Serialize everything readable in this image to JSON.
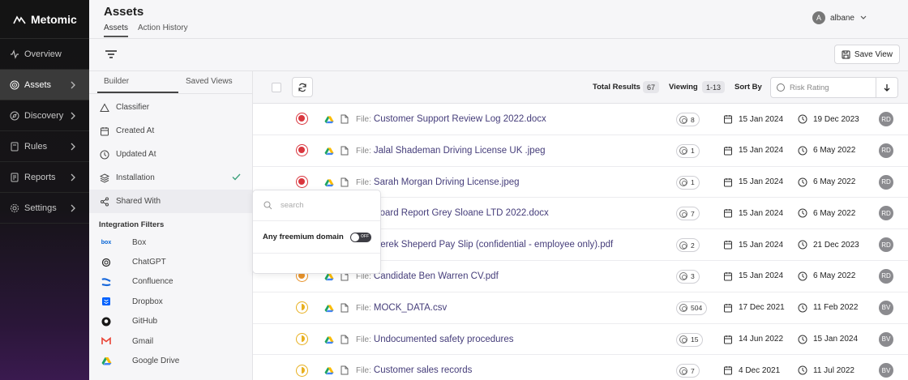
{
  "app": {
    "name": "Metomic"
  },
  "sidebar": {
    "items": [
      {
        "label": "Overview",
        "icon": "activity-icon"
      },
      {
        "label": "Assets",
        "icon": "target-icon",
        "active": true
      },
      {
        "label": "Discovery",
        "icon": "compass-icon"
      },
      {
        "label": "Rules",
        "icon": "book-icon"
      },
      {
        "label": "Reports",
        "icon": "report-icon"
      },
      {
        "label": "Settings",
        "icon": "gear-icon"
      }
    ]
  },
  "header": {
    "title": "Assets",
    "tabs": [
      {
        "label": "Assets",
        "active": true
      },
      {
        "label": "Action History"
      }
    ],
    "user": {
      "initial": "A",
      "name": "albane"
    }
  },
  "toolbar": {
    "save_label": "Save View"
  },
  "panel": {
    "tabs": [
      {
        "label": "Builder",
        "active": true
      },
      {
        "label": "Saved Views"
      }
    ],
    "filters": [
      {
        "label": "Classifier",
        "icon": "triangle-icon"
      },
      {
        "label": "Created At",
        "icon": "calendar-icon"
      },
      {
        "label": "Updated At",
        "icon": "clock-icon"
      },
      {
        "label": "Installation",
        "icon": "layers-icon",
        "checked": true
      },
      {
        "label": "Shared With",
        "icon": "share-icon",
        "selected": true
      }
    ],
    "integration_heading": "Integration Filters",
    "integrations": [
      {
        "label": "Box",
        "icon": "box-icon",
        "color": "#0061d5"
      },
      {
        "label": "ChatGPT",
        "icon": "chatgpt-icon",
        "color": "#222222"
      },
      {
        "label": "Confluence",
        "icon": "confluence-icon",
        "color": "#1868db"
      },
      {
        "label": "Dropbox",
        "icon": "dropbox-icon",
        "color": "#0061fe"
      },
      {
        "label": "GitHub",
        "icon": "github-icon",
        "color": "#181717"
      },
      {
        "label": "Gmail",
        "icon": "gmail-icon",
        "color": "#ea4335"
      },
      {
        "label": "Google Drive",
        "icon": "google-drive-icon",
        "color": "#1fa463"
      }
    ]
  },
  "table": {
    "total_label": "Total Results",
    "total_value": "67",
    "viewing_label": "Viewing",
    "viewing_value": "1-13",
    "sort_label": "Sort By",
    "sort_value": "Risk Rating",
    "file_prefix": "File:",
    "rows": [
      {
        "risk": "high",
        "name": "Customer Support Review Log 2022.docx",
        "count": "8",
        "created": "15 Jan 2024",
        "updated": "19 Dec 2023",
        "owner": "RD"
      },
      {
        "risk": "high",
        "name": "Jalal Shademan Driving License UK .jpeg",
        "count": "1",
        "created": "15 Jan 2024",
        "updated": "6 May 2022",
        "owner": "RD"
      },
      {
        "risk": "high",
        "name": "Sarah Morgan Driving License.jpeg",
        "count": "1",
        "created": "15 Jan 2024",
        "updated": "6 May 2022",
        "owner": "RD"
      },
      {
        "risk": "high",
        "name": "Board Report Grey Sloane LTD 2022.docx",
        "count": "7",
        "created": "15 Jan 2024",
        "updated": "6 May 2022",
        "owner": "RD"
      },
      {
        "risk": "high",
        "name": "Derek Sheperd Pay Slip (confidential - employee only).pdf",
        "count": "2",
        "created": "15 Jan 2024",
        "updated": "21 Dec 2023",
        "owner": "RD"
      },
      {
        "risk": "medhigh",
        "name": "Candidate Ben Warren CV.pdf",
        "count": "3",
        "created": "15 Jan 2024",
        "updated": "6 May 2022",
        "owner": "RD"
      },
      {
        "risk": "med",
        "name": "MOCK_DATA.csv",
        "count": "504",
        "created": "17 Dec 2021",
        "updated": "11 Feb 2022",
        "owner": "BV"
      },
      {
        "risk": "med",
        "name": "Undocumented safety procedures",
        "count": "15",
        "created": "14 Jun 2022",
        "updated": "15 Jan 2024",
        "owner": "BV"
      },
      {
        "risk": "med",
        "name": "Customer sales records",
        "count": "7",
        "created": "4 Dec 2021",
        "updated": "11 Jul 2022",
        "owner": "BV"
      }
    ]
  },
  "popover": {
    "search_placeholder": "search",
    "option_label": "Any freemium domain",
    "toggle_text": "OFF"
  }
}
